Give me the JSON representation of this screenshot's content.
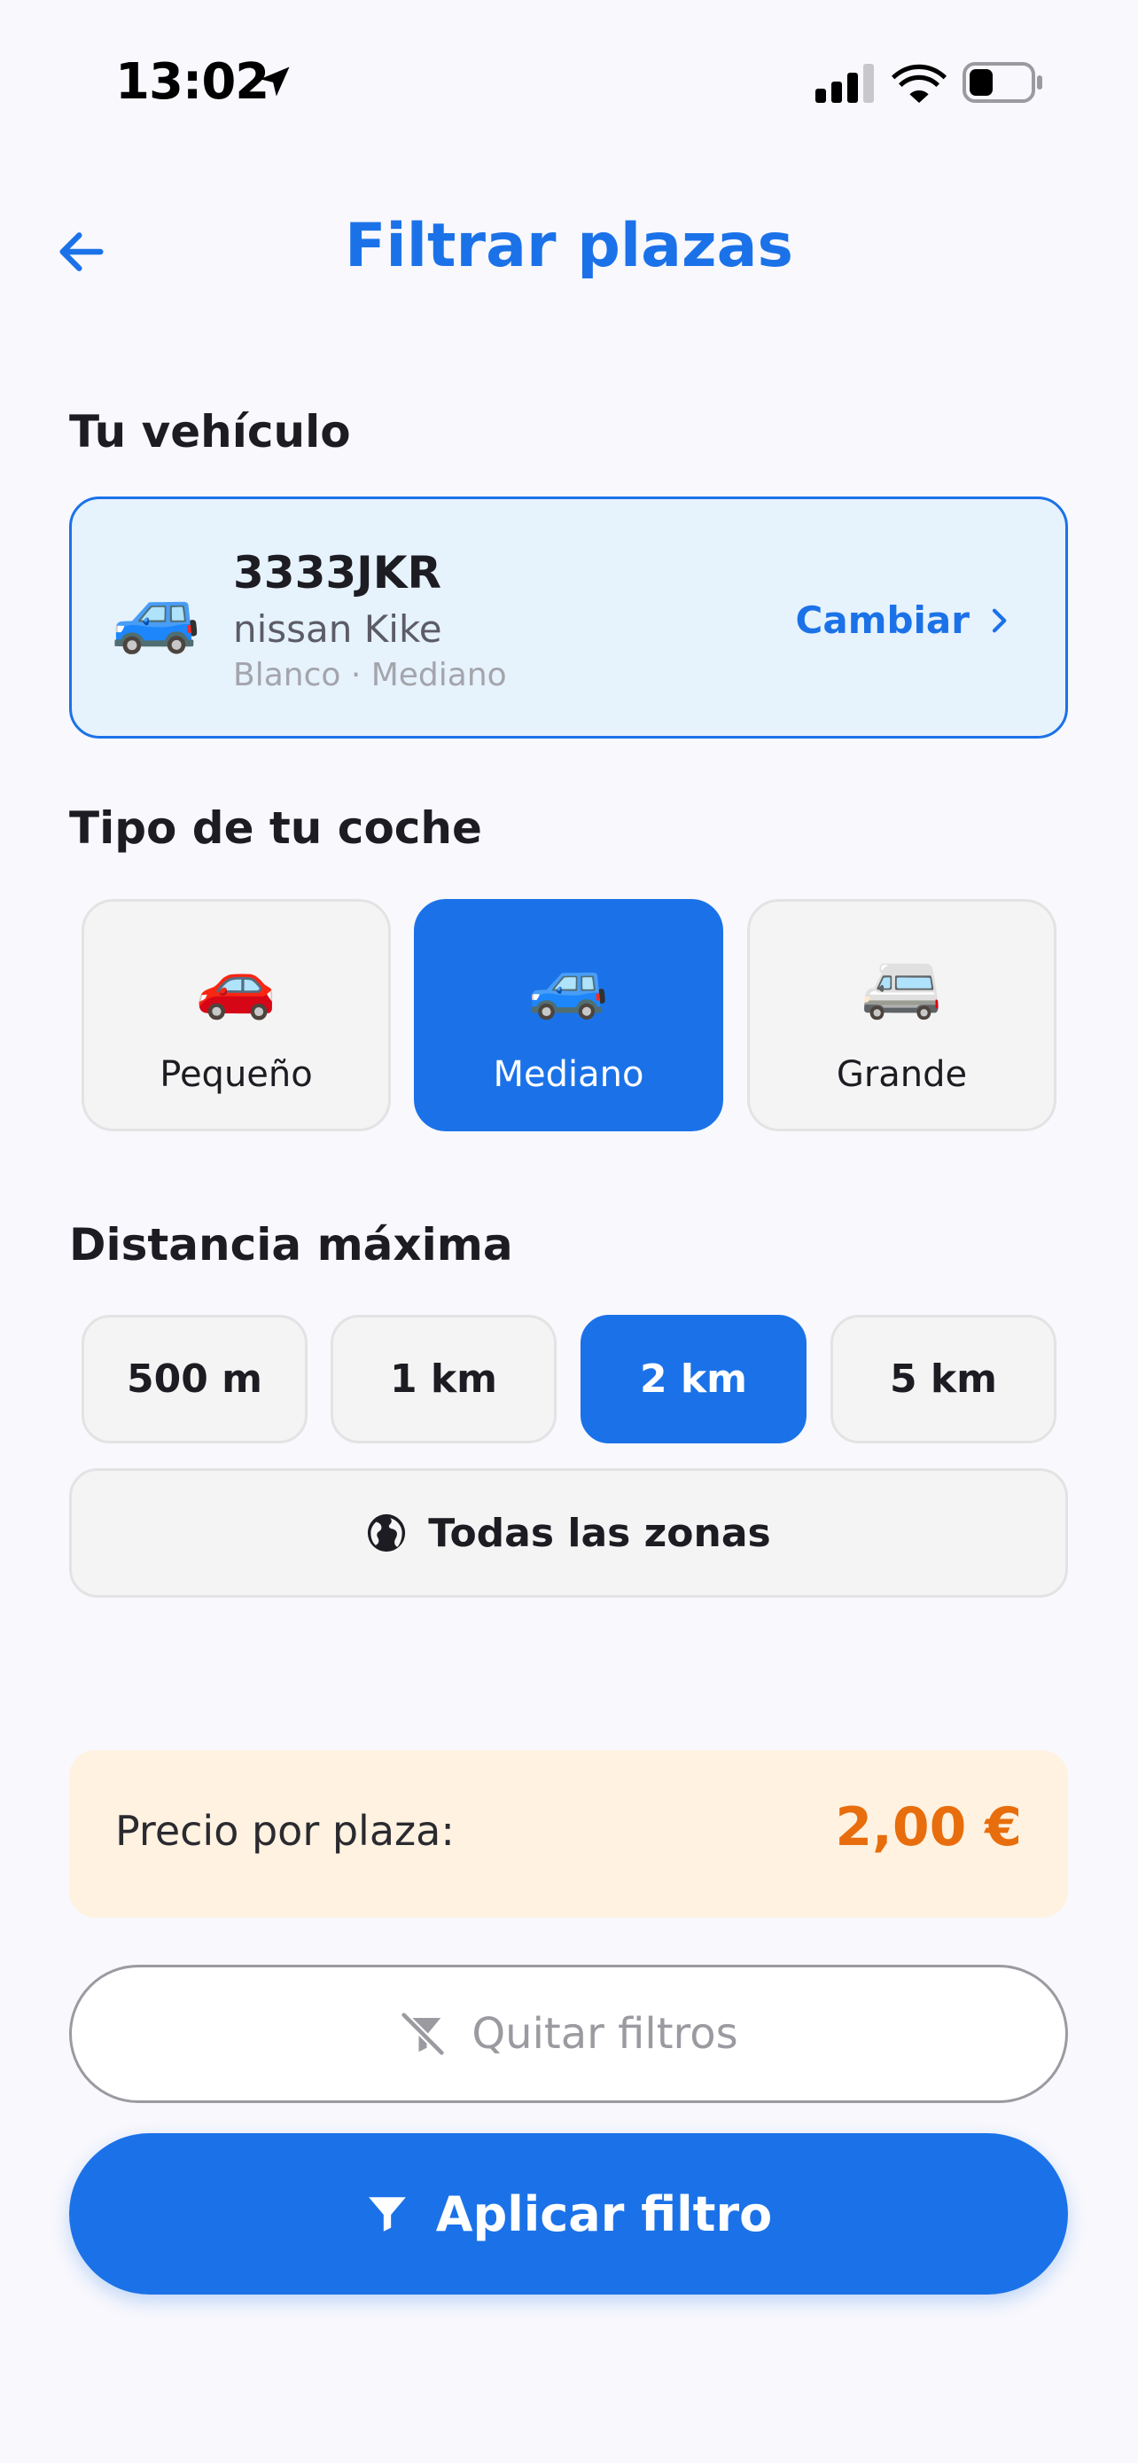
{
  "status_bar": {
    "time": "13:02"
  },
  "header": {
    "title": "Filtrar plazas"
  },
  "vehicle_section": {
    "title": "Tu vehículo",
    "vehicle": {
      "emoji": "🚙",
      "plate": "3333JKR",
      "model": "nissan Kike",
      "details": "Blanco · Mediano"
    },
    "change_label": "Cambiar"
  },
  "car_type_section": {
    "title": "Tipo de tu coche",
    "options": [
      {
        "emoji": "🚗",
        "label": "Pequeño",
        "selected": false
      },
      {
        "emoji": "🚙",
        "label": "Mediano",
        "selected": true
      },
      {
        "emoji": "🚐",
        "label": "Grande",
        "selected": false
      }
    ]
  },
  "distance_section": {
    "title": "Distancia máxima",
    "options": [
      {
        "label": "500 m",
        "selected": false
      },
      {
        "label": "1 km",
        "selected": false
      },
      {
        "label": "2 km",
        "selected": true
      },
      {
        "label": "5 km",
        "selected": false
      }
    ],
    "all_zones_label": "Todas las zonas"
  },
  "price": {
    "label": "Precio por plaza:",
    "value": "2,00 €"
  },
  "actions": {
    "clear_label": "Quitar filtros",
    "apply_label": "Aplicar filtro"
  },
  "colors": {
    "accent": "#1b72e8",
    "price": "#e86d0c",
    "background": "#f8f8fd"
  }
}
